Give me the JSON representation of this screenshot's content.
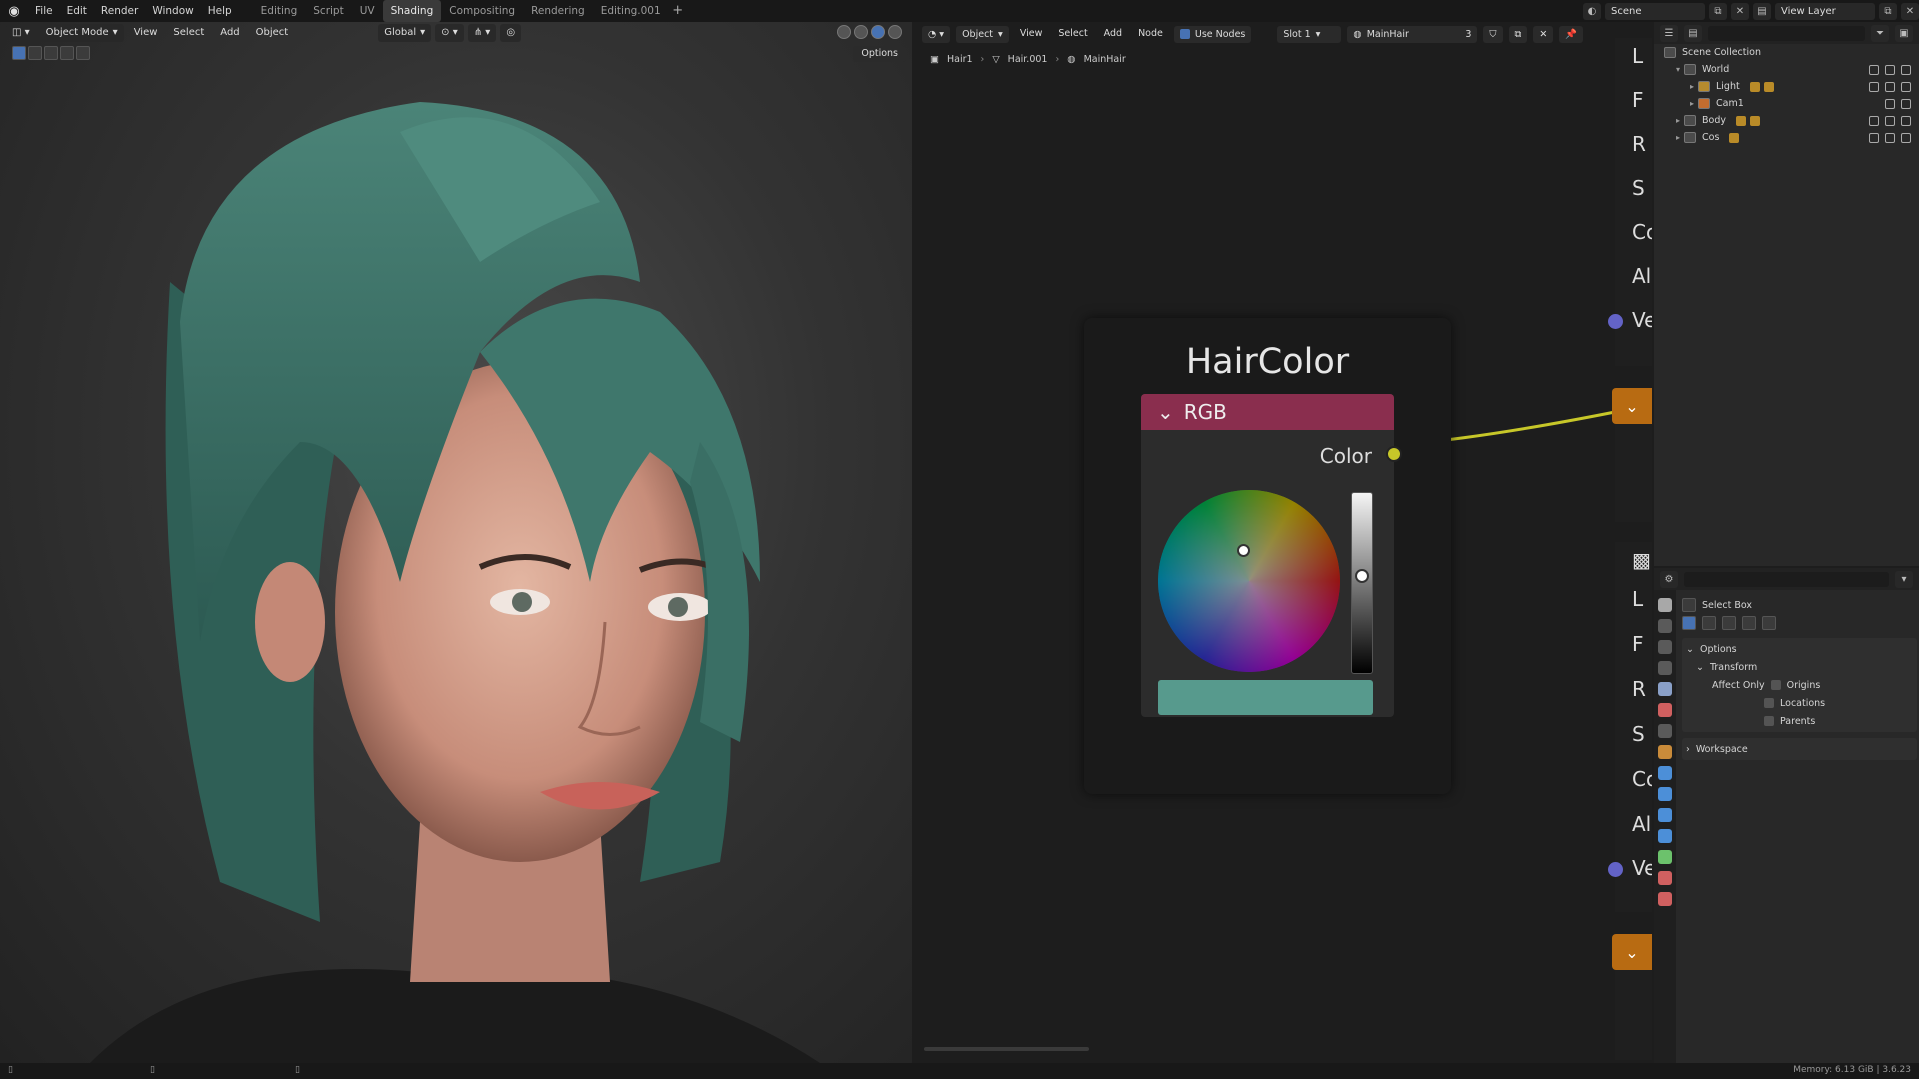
{
  "topbar": {
    "menus": [
      "File",
      "Edit",
      "Render",
      "Window",
      "Help"
    ],
    "workspaces": [
      "Editing",
      "Script",
      "UV",
      "Shading",
      "Compositing",
      "Rendering",
      "Editing.001"
    ],
    "active_workspace": "Shading",
    "scene": "Scene",
    "view_layer": "View Layer"
  },
  "viewport": {
    "mode": "Object Mode",
    "menus": [
      "View",
      "Select",
      "Add",
      "Object"
    ],
    "orientation": "Global",
    "options": "Options"
  },
  "node_editor": {
    "type": "Object",
    "menus": [
      "View",
      "Select",
      "Add",
      "Node"
    ],
    "use_nodes": "Use Nodes",
    "slot": "Slot 1",
    "material": "MainHair",
    "users": "3",
    "breadcrumb": [
      "Hair1",
      "Hair.001",
      "MainHair"
    ],
    "node": {
      "title": "HairColor",
      "header": "RGB",
      "output": "Color",
      "color": "#579a8d"
    },
    "side_letters": [
      "L",
      "F",
      "R",
      "S",
      "Co",
      "Alp",
      "Ve",
      "L",
      "F",
      "R",
      "S",
      "Co",
      "Alp",
      "Ve"
    ]
  },
  "outliner": {
    "root": "Scene Collection",
    "items": [
      {
        "label": "World",
        "icon": "collection-icon"
      },
      {
        "label": "Light",
        "icon": "light-icon"
      },
      {
        "label": "Cam1",
        "icon": "camera-icon"
      },
      {
        "label": "Body",
        "icon": "collection-icon"
      },
      {
        "label": "Cos",
        "icon": "collection-icon"
      }
    ]
  },
  "properties": {
    "tool": "Select Box",
    "panel_options": "Options",
    "panel_transform": "Transform",
    "affect_only": "Affect Only",
    "origins": "Origins",
    "locations": "Locations",
    "parents": "Parents",
    "workspace": "Workspace"
  },
  "status": {
    "memory": "Memory: 6.13 GiB | 3.6.23"
  },
  "colors": {
    "accent": "#4772b3",
    "rgb_node_header": "#8a2e4e",
    "socket_color": "#c7c729",
    "vector_socket": "#6363c7",
    "group_orange": "#b86b12"
  }
}
